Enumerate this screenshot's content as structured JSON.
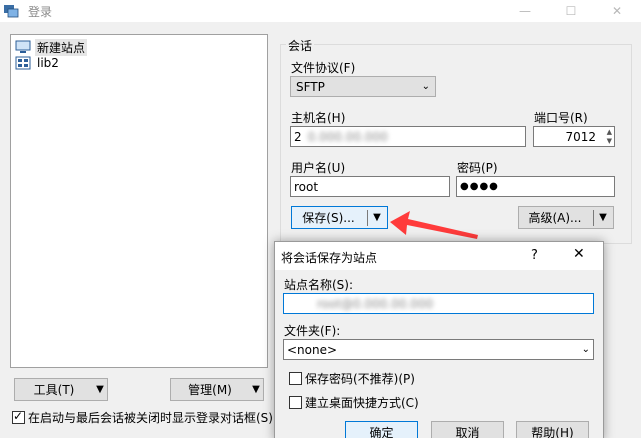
{
  "window": {
    "title": "登录",
    "minimize_glyph": "—",
    "maximize_glyph": "☐",
    "close_glyph": "✕"
  },
  "sites": [
    {
      "label": "新建站点",
      "icon": "monitor-icon",
      "selected": true
    },
    {
      "label": "lib2",
      "icon": "site-icon",
      "selected": false
    }
  ],
  "left_buttons": {
    "tools_label": "工具(T)",
    "manage_label": "管理(M)",
    "arrow_glyph": "▼"
  },
  "startup_check": {
    "label": "在启动与最后会话被关闭时显示登录对话框(S)",
    "checked": true
  },
  "session": {
    "group_label": "会话",
    "protocol_label": "文件协议(F)",
    "protocol_value": "SFTP",
    "host_label": "主机名(H)",
    "host_value": "2",
    "host_redacted": "0.000.00.000",
    "port_label": "端口号(R)",
    "port_value": "7012",
    "user_label": "用户名(U)",
    "user_value": "root",
    "password_label": "密码(P)",
    "password_value": "●●●●",
    "save_label": "保存(S)...",
    "advanced_label": "高级(A)..."
  },
  "save_dialog": {
    "title": "将会话保存为站点",
    "help_glyph": "?",
    "close_glyph": "✕",
    "site_name_label": "站点名称(S):",
    "site_name_redacted": "root@0.000.00.000",
    "folder_label": "文件夹(F):",
    "folder_value": "<none>",
    "save_password_label": "保存密码(不推荐)(P)",
    "save_password_checked": false,
    "desktop_shortcut_label": "建立桌面快捷方式(C)",
    "desktop_shortcut_checked": false,
    "ok_label": "确定",
    "cancel_label": "取消",
    "help_label": "帮助(H)"
  },
  "colors": {
    "accent_blue": "#0078d7",
    "annotation_red": "#ff3b3b"
  }
}
